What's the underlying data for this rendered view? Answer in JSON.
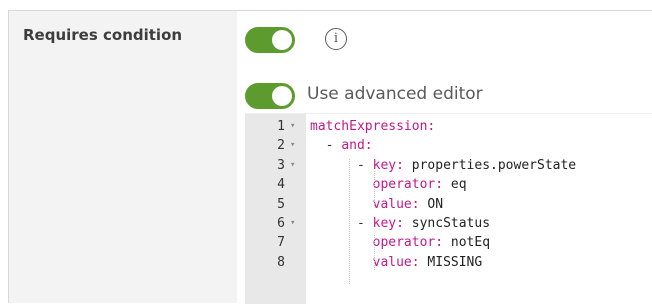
{
  "field": {
    "label": "Requires condition",
    "toggle_on": true,
    "info_icon": "info-circle-icon"
  },
  "advanced": {
    "label": "Use advanced editor",
    "toggle_on": true
  },
  "colors": {
    "toggle_on": "#5d9b2e",
    "yaml_key": "#c2198b"
  },
  "editor": {
    "lines": [
      {
        "num": "1",
        "fold": "▾",
        "indent": "",
        "dash": "",
        "key": "matchExpression:",
        "value": ""
      },
      {
        "num": "2",
        "fold": "▾",
        "indent": "  ",
        "dash": "- ",
        "key": "and:",
        "value": ""
      },
      {
        "num": "3",
        "fold": "▾",
        "indent": "      ",
        "dash": "- ",
        "key": "key:",
        "value": " properties.powerState"
      },
      {
        "num": "4",
        "fold": "",
        "indent": "        ",
        "dash": "",
        "key": "operator:",
        "value": " eq"
      },
      {
        "num": "5",
        "fold": "",
        "indent": "        ",
        "dash": "",
        "key": "value:",
        "value": " ON"
      },
      {
        "num": "6",
        "fold": "▾",
        "indent": "      ",
        "dash": "- ",
        "key": "key:",
        "value": " syncStatus"
      },
      {
        "num": "7",
        "fold": "",
        "indent": "        ",
        "dash": "",
        "key": "operator:",
        "value": " notEq"
      },
      {
        "num": "8",
        "fold": "",
        "indent": "        ",
        "dash": "",
        "key": "value:",
        "value": " MISSING"
      }
    ]
  }
}
